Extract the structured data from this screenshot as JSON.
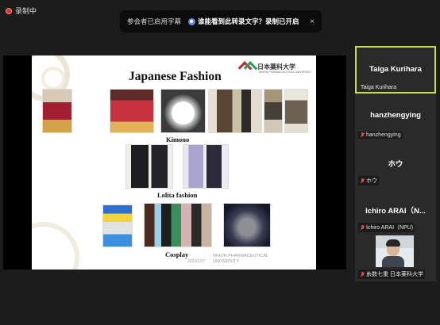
{
  "recording": {
    "label": "录制中"
  },
  "caption_bar": {
    "text": "参会者已启用字幕",
    "question": "谁能看到此转录文字？录制已开启",
    "close": "×"
  },
  "slide": {
    "title": "Japanese Fashion",
    "logo_text": "日本薬科大学",
    "logo_sub": "NIHON PHARMACEUTICAL UNIVERSITY",
    "captions": {
      "kimono": "Kimono",
      "lolita": "Lolita fashion",
      "cosplay": "Cosplay"
    },
    "date": "2022/12/7",
    "footer": "NIHON PHARMACEUTICAL UNIVERSITY"
  },
  "participants": [
    {
      "name": "Taiga Kurihara",
      "label": "Taiga Kurihara",
      "active": true
    },
    {
      "name": "hanzhengying",
      "label": "hanzhengying",
      "muted": true
    },
    {
      "name": "ホウ",
      "label": "ホウ",
      "muted": true
    },
    {
      "name": "Ichiro ARAI（N...",
      "label": "Ichiro ARAI（NPU)",
      "muted": true
    },
    {
      "label": "糸数七重  日本薬科大学",
      "muted": true,
      "video": true
    }
  ],
  "colors": {
    "active_border": "#c5df4c",
    "record_red": "#e5322d",
    "muted_red": "#e04848"
  }
}
